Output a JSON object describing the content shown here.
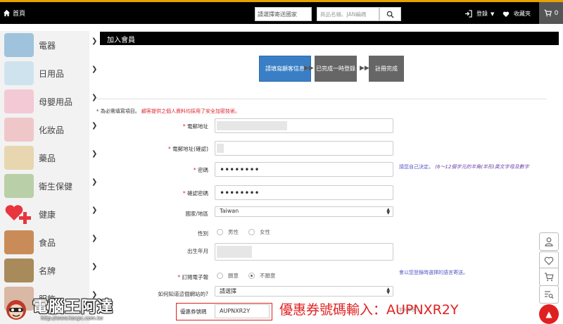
{
  "topbar": {
    "home_label": "首頁",
    "country_placeholder": "請選擇寄送國家",
    "search_placeholder": "商品名稱、JAN編碼",
    "login_label": "登錄",
    "favorites_label": "收藏夾",
    "cart_count": "0"
  },
  "sidebar": {
    "categories": [
      {
        "label": "電器",
        "color": "#9fc3dc"
      },
      {
        "label": "日用品",
        "color": "#cfe3ee"
      },
      {
        "label": "母嬰用品",
        "color": "#f3c9d6"
      },
      {
        "label": "化妝品",
        "color": "#f0c7c9"
      },
      {
        "label": "藥品",
        "color": "#e8d6b0"
      },
      {
        "label": "衛生保健",
        "color": "#b9cfa8"
      },
      {
        "label": "健康",
        "color": "#e8353e"
      },
      {
        "label": "食品",
        "color": "#c98c58"
      },
      {
        "label": "名牌",
        "color": "#a88a5b"
      },
      {
        "label": "服飾",
        "color": "#d9b8a5"
      }
    ]
  },
  "page": {
    "title": "加入會員",
    "steps": [
      "請填寫顧客信息",
      "已完成一時登錄",
      "註冊完成"
    ]
  },
  "form": {
    "required_note_star": "* 為必需填寫項目。",
    "required_note_red": "顧客提供之個人資料均採用了安全加密技術。",
    "email_label": "電郵地址",
    "email_confirm_label": "電郵地址(確認)",
    "password_label": "密碼",
    "password_value": "••••••••",
    "password_hint_prefix": "請您自己決定。",
    "password_hint_rule": "(6～12個字元的半角(半形)英文字母及數字",
    "confirm_password_label": "確認密碼",
    "confirm_password_value": "••••••••",
    "country_label": "國家/地區",
    "country_value": "Taiwan",
    "gender_label": "性別",
    "gender_male": "男性",
    "gender_female": "女性",
    "birthday_label": "出生年月",
    "newsletter_label": "訂閱電子報",
    "newsletter_yes": "願意",
    "newsletter_no": "不願意",
    "newsletter_hint": "會以您登錄時選擇的語言寄送。",
    "referral_label": "如何知道這個網站的?",
    "referral_value": "請選擇",
    "coupon_label": "優惠券號碼",
    "coupon_value": "AUPNXR2Y",
    "coupon_hint_tail": "半)(半形)"
  },
  "annotation": {
    "text": "優惠券號碼輸入：AUPNXR2Y"
  },
  "watermark": {
    "title": "電腦王阿達",
    "url": "http://www.kocpc.com.tw"
  }
}
